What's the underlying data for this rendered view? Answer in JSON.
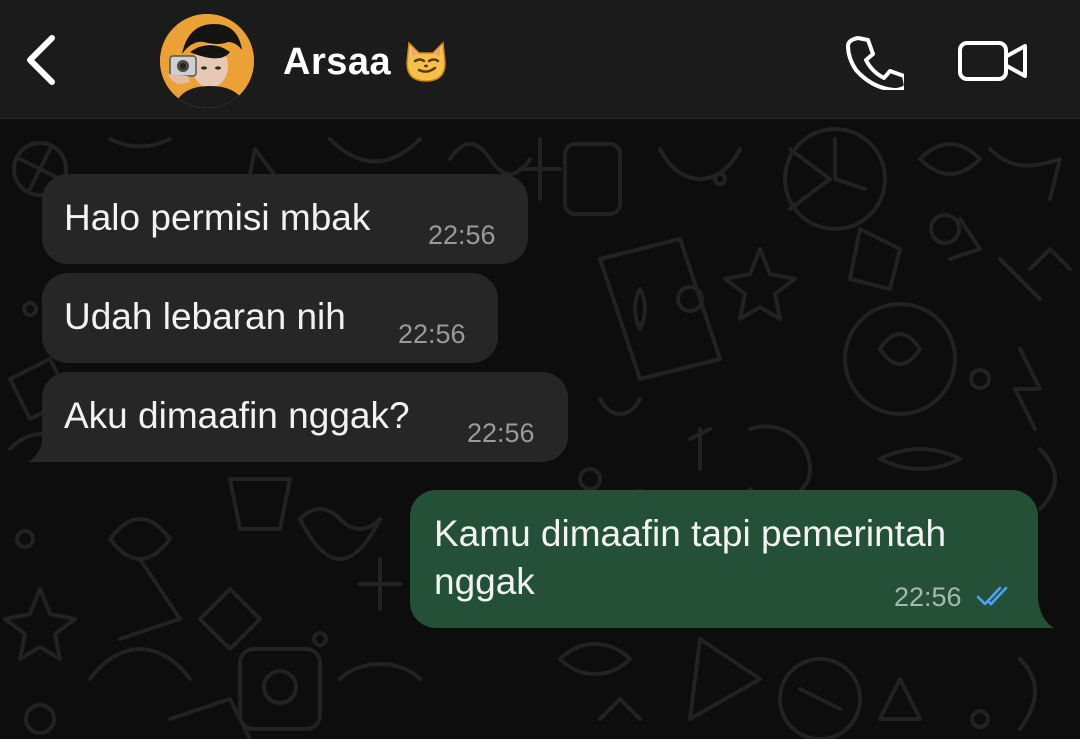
{
  "header": {
    "back_icon": "chevron-left-icon",
    "contact_name": "Arsaa",
    "contact_emoji": "smirking-cat-emoji",
    "call_icon": "phone-icon",
    "video_icon": "video-camera-icon"
  },
  "messages": [
    {
      "direction": "incoming",
      "text": "Halo permisi mbak",
      "time": "22:56"
    },
    {
      "direction": "incoming",
      "text": "Udah lebaran nih",
      "time": "22:56"
    },
    {
      "direction": "incoming",
      "text": "Aku dimaafin nggak?",
      "time": "22:56"
    },
    {
      "direction": "outgoing",
      "text_line1": "Kamu dimaafin tapi pemerintah",
      "text_line2": "nggak",
      "time": "22:56",
      "status": "read-double-check"
    }
  ],
  "colors": {
    "header_bg": "#1b1b1b",
    "incoming_bubble": "#262626",
    "outgoing_bubble": "#235037",
    "read_check": "#4fa3f7",
    "wallpaper_doodle": "#1e1e1e"
  }
}
